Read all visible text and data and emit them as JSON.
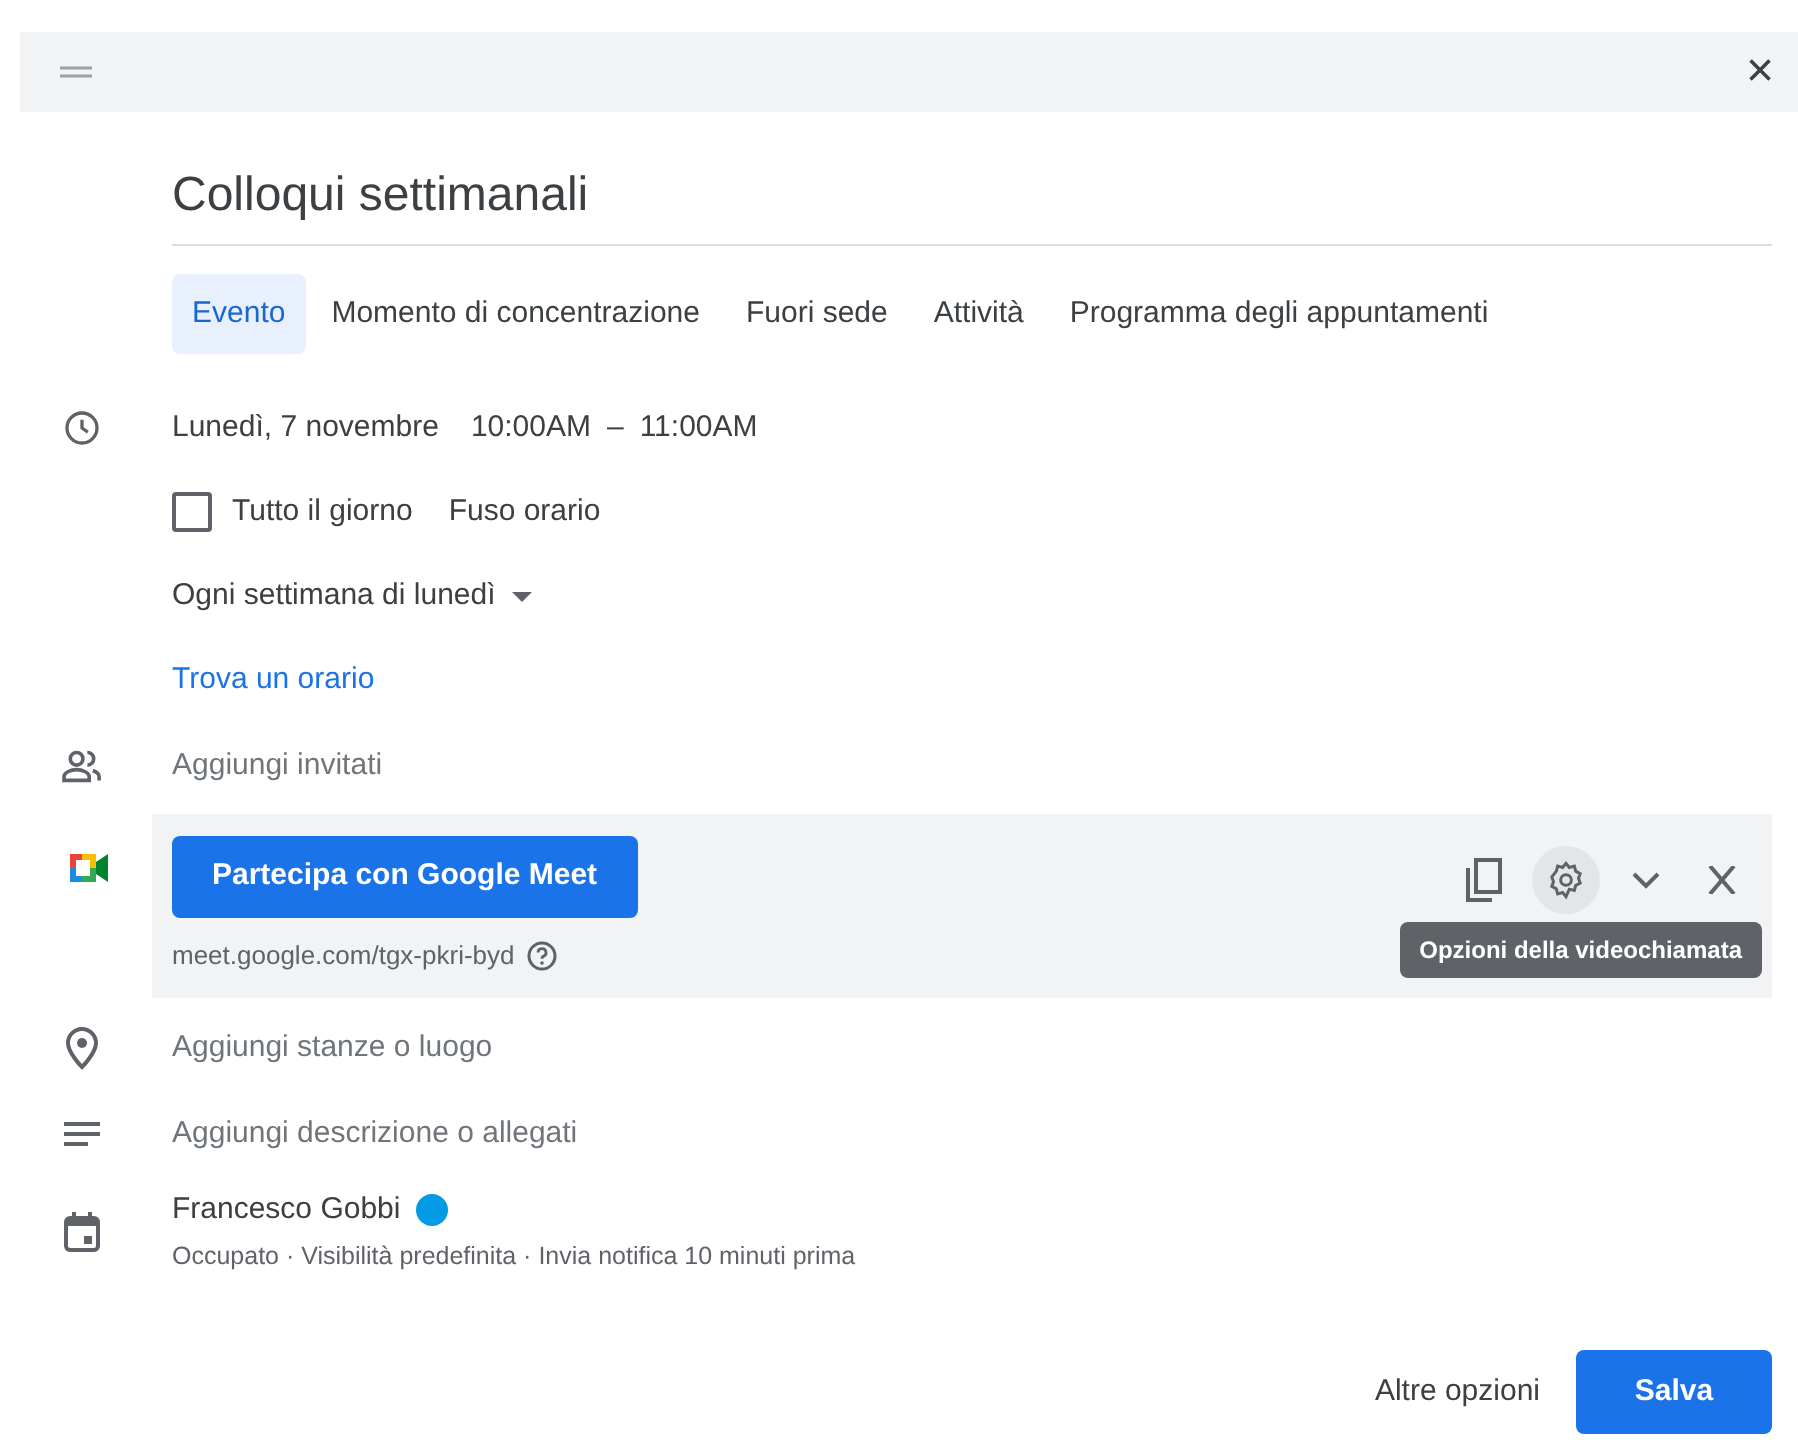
{
  "header": {
    "close": "×"
  },
  "title": "Colloqui settimanali",
  "tabs": [
    {
      "label": "Evento",
      "selected": true
    },
    {
      "label": "Momento di concentrazione",
      "selected": false
    },
    {
      "label": "Fuori sede",
      "selected": false
    },
    {
      "label": "Attività",
      "selected": false
    },
    {
      "label": "Programma degli appuntamenti",
      "selected": false
    }
  ],
  "when": {
    "date": "Lunedì, 7 novembre",
    "start": "10:00AM",
    "dash": "–",
    "end": "11:00AM"
  },
  "all_day": {
    "label": "Tutto il giorno",
    "checked": false
  },
  "timezone": "Fuso orario",
  "recurrence": "Ogni settimana di lunedì",
  "find_time": "Trova un orario",
  "guests": {
    "placeholder": "Aggiungi invitati"
  },
  "meet": {
    "button": "Partecipa con Google Meet",
    "link": "meet.google.com/tgx-pkri-byd",
    "tooltip": "Opzioni della videochiamata"
  },
  "location": {
    "placeholder": "Aggiungi stanze o luogo"
  },
  "description": {
    "placeholder": "Aggiungi descrizione o allegati"
  },
  "calendar": {
    "owner": "Francesco Gobbi",
    "color": "#039be5",
    "details": "Occupato · Visibilità predefinita · Invia notifica 10 minuti prima"
  },
  "footer": {
    "more": "Altre opzioni",
    "save": "Salva"
  }
}
